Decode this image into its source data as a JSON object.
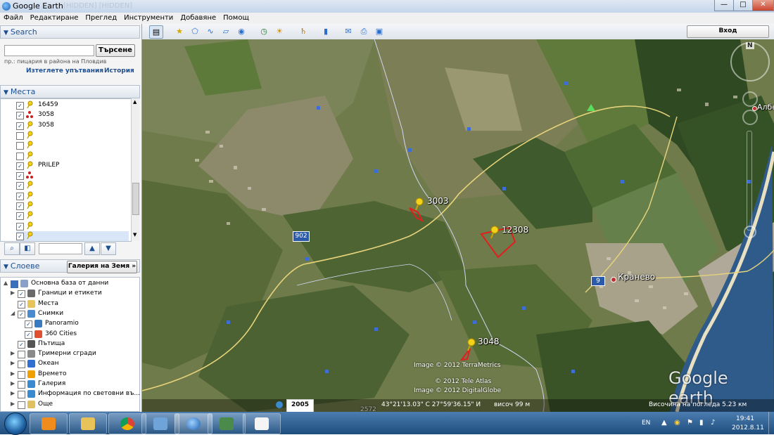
{
  "window": {
    "title": "Google Earth",
    "faded_tab_text": "[HIDDEN] [HIDDEN]"
  },
  "window_controls": {
    "minimize": "—",
    "maximize": "□",
    "close": "✕"
  },
  "menu": [
    "Файл",
    "Редактиране",
    "Преглед",
    "Инструменти",
    "Добавяне",
    "Помощ"
  ],
  "search": {
    "header": "Search",
    "input_value": "",
    "button_label": "Търсене",
    "hint": "пр.: пицария в района на Пловдив",
    "clear_label": "Изтеглете упътвания",
    "history_label": "История"
  },
  "places": {
    "header": "Места",
    "items": [
      {
        "label": "16459",
        "checked": true,
        "icon": "pushpin-icon"
      },
      {
        "label": "3058",
        "checked": true,
        "icon": "polygon-icon"
      },
      {
        "label": "3058",
        "checked": true,
        "icon": "pushpin-icon"
      },
      {
        "label": "",
        "checked": false,
        "icon": "pushpin-icon"
      },
      {
        "label": "",
        "checked": false,
        "icon": "pushpin-icon"
      },
      {
        "label": "",
        "checked": false,
        "icon": "pushpin-icon"
      },
      {
        "label": "PRILEP",
        "checked": true,
        "icon": "pushpin-icon"
      },
      {
        "label": "",
        "checked": true,
        "icon": "polygon-icon"
      },
      {
        "label": "",
        "checked": true,
        "icon": "pushpin-icon"
      },
      {
        "label": "",
        "checked": true,
        "icon": "pushpin-icon"
      },
      {
        "label": "",
        "checked": true,
        "icon": "pushpin-icon"
      },
      {
        "label": "",
        "checked": true,
        "icon": "pushpin-icon"
      },
      {
        "label": "",
        "checked": true,
        "icon": "pushpin-icon"
      },
      {
        "label": "",
        "checked": true,
        "icon": "pushpin-icon"
      }
    ]
  },
  "layers": {
    "header": "Слоеве",
    "gallery_button": "Галерия на Земя",
    "items": [
      {
        "label": "Основна база от данни",
        "checked": null,
        "expander": "▲",
        "indent": 0
      },
      {
        "label": "Граници и етикети",
        "checked": true,
        "expander": "▶",
        "indent": 1
      },
      {
        "label": "Места",
        "checked": true,
        "expander": "",
        "indent": 1
      },
      {
        "label": "Снимки",
        "checked": true,
        "expander": "◢",
        "indent": 1
      },
      {
        "label": "Panoramio",
        "checked": true,
        "expander": "",
        "indent": 2
      },
      {
        "label": "360 Cities",
        "checked": true,
        "expander": "",
        "indent": 2
      },
      {
        "label": "Пътища",
        "checked": true,
        "expander": "",
        "indent": 1
      },
      {
        "label": "Тримерни сгради",
        "checked": false,
        "expander": "▶",
        "indent": 1
      },
      {
        "label": "Океан",
        "checked": false,
        "expander": "▶",
        "indent": 1
      },
      {
        "label": "Времето",
        "checked": false,
        "expander": "▶",
        "indent": 1
      },
      {
        "label": "Галерия",
        "checked": false,
        "expander": "▶",
        "indent": 1
      },
      {
        "label": "Информация по световни въ...",
        "checked": false,
        "expander": "▶",
        "indent": 1
      },
      {
        "label": "Още",
        "checked": false,
        "expander": "▶",
        "indent": 1
      }
    ]
  },
  "toolbar": {
    "login_label": "Вход"
  },
  "map": {
    "placemarks": [
      "3003",
      "12308",
      "3048"
    ],
    "town": "Кранево",
    "road_902": "902",
    "road_9": "9",
    "edge_label": "Албе",
    "attribution": [
      "Image © 2012 TerraMetrics",
      "© 2012 Tele Atlas",
      "Image © 2012 DigitalGlobe"
    ],
    "logo": "Google earth",
    "year": "2005",
    "coords": "43°21'13.03\" С  27°59'36.15\" И",
    "elevation_label": "височ",
    "elevation": "99 м",
    "eye_alt": "Височина на погледа   5.23 км",
    "compass": "N",
    "partial_label": "2572"
  },
  "taskbar": {
    "lang": "EN",
    "time": "19:41",
    "date": "2012.8.11"
  }
}
